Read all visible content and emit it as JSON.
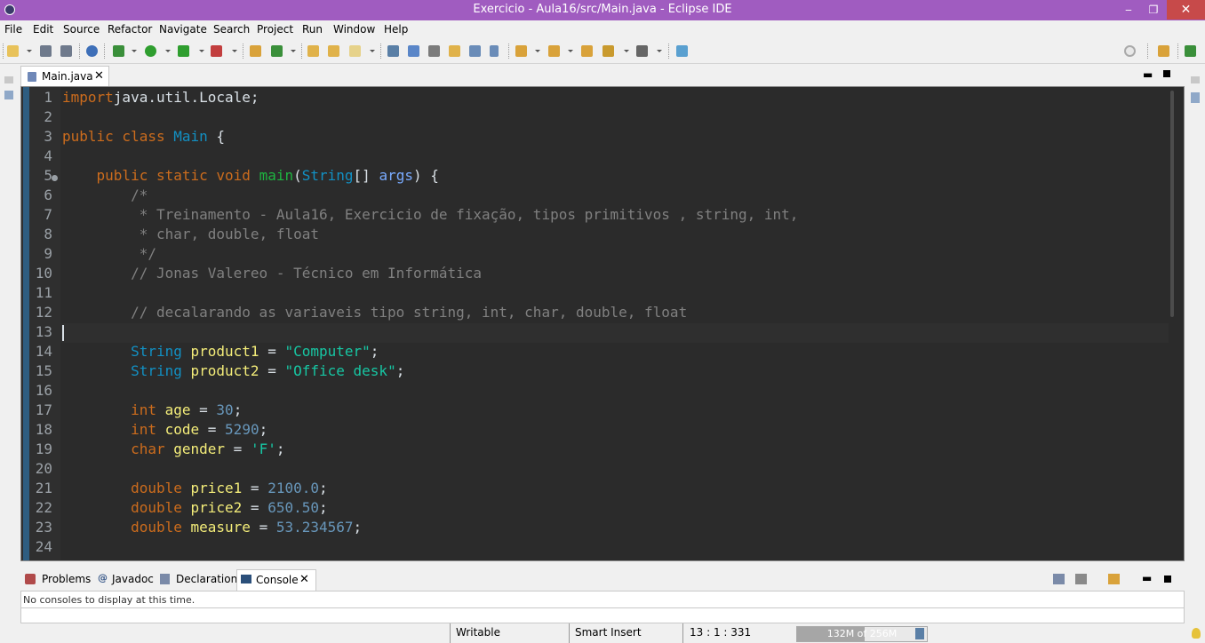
{
  "window": {
    "title": "Exercicio - Aula16/src/Main.java - Eclipse IDE",
    "minimize": "‒",
    "restore": "❐",
    "close": "✕"
  },
  "menu": [
    "File",
    "Edit",
    "Source",
    "Refactor",
    "Navigate",
    "Search",
    "Project",
    "Run",
    "Window",
    "Help"
  ],
  "editor": {
    "tab_label": "Main.java",
    "tab_close": "✕",
    "current_line": 13,
    "line_numbers": [
      "1",
      "2",
      "3",
      "4",
      "5",
      "6",
      "7",
      "8",
      "9",
      "10",
      "11",
      "12",
      "13",
      "14",
      "15",
      "16",
      "17",
      "18",
      "19",
      "20",
      "21",
      "22",
      "23",
      "24"
    ],
    "lines": [
      [
        [
          "k",
          "import"
        ],
        [
          "",
          "java.util.Locale;"
        ]
      ],
      [],
      [
        [
          "k",
          "public class"
        ],
        [
          "",
          " "
        ],
        [
          "cl",
          "Main"
        ],
        [
          "",
          " {"
        ]
      ],
      [],
      [
        [
          "",
          ""
        ],
        [
          "k",
          "    public static void"
        ],
        [
          "",
          " "
        ],
        [
          "m",
          "main"
        ],
        [
          "",
          "("
        ],
        [
          "cl",
          "String"
        ],
        [
          "",
          "[] "
        ],
        [
          "p",
          "args"
        ],
        [
          "",
          ") {"
        ]
      ],
      [
        [
          "c",
          "        /*"
        ]
      ],
      [
        [
          "c",
          "         * Treinamento - Aula16, Exercicio de fixação, tipos primitivos , string, int,"
        ]
      ],
      [
        [
          "c",
          "         * char, double, float"
        ]
      ],
      [
        [
          "c",
          "         */"
        ]
      ],
      [
        [
          "c",
          "        // Jonas Valereo - Técnico em Informática"
        ]
      ],
      [],
      [
        [
          "c",
          "        // decalarando as variaveis tipo string, int, char, double, float"
        ]
      ],
      [],
      [
        [
          "cl",
          "        String"
        ],
        [
          "",
          " "
        ],
        [
          "v",
          "product1"
        ],
        [
          "",
          " = "
        ],
        [
          "s",
          "\"Computer\""
        ],
        [
          "",
          ";"
        ]
      ],
      [
        [
          "cl",
          "        String"
        ],
        [
          "",
          " "
        ],
        [
          "v",
          "product2"
        ],
        [
          "",
          " = "
        ],
        [
          "s",
          "\"Office desk\""
        ],
        [
          "",
          ";"
        ]
      ],
      [],
      [
        [
          "k",
          "        int"
        ],
        [
          "",
          " "
        ],
        [
          "v",
          "age"
        ],
        [
          "",
          " = "
        ],
        [
          "n",
          "30"
        ],
        [
          "",
          ";"
        ]
      ],
      [
        [
          "k",
          "        int"
        ],
        [
          "",
          " "
        ],
        [
          "v",
          "code"
        ],
        [
          "",
          " = "
        ],
        [
          "n",
          "5290"
        ],
        [
          "",
          ";"
        ]
      ],
      [
        [
          "k",
          "        char"
        ],
        [
          "",
          " "
        ],
        [
          "v",
          "gender"
        ],
        [
          "",
          " = "
        ],
        [
          "s",
          "'F'"
        ],
        [
          "",
          ";"
        ]
      ],
      [],
      [
        [
          "k",
          "        double"
        ],
        [
          "",
          " "
        ],
        [
          "v",
          "price1"
        ],
        [
          "",
          " = "
        ],
        [
          "n",
          "2100.0"
        ],
        [
          "",
          ";"
        ]
      ],
      [
        [
          "k",
          "        double"
        ],
        [
          "",
          " "
        ],
        [
          "v",
          "price2"
        ],
        [
          "",
          " = "
        ],
        [
          "n",
          "650.50"
        ],
        [
          "",
          ";"
        ]
      ],
      [
        [
          "k",
          "        double"
        ],
        [
          "",
          " "
        ],
        [
          "v",
          "measure"
        ],
        [
          "",
          " = "
        ],
        [
          "n",
          "53.234567"
        ],
        [
          "",
          ";"
        ]
      ],
      []
    ]
  },
  "bottom_panel": {
    "tabs": [
      "Problems",
      "Javadoc",
      "Declaration",
      "Console"
    ],
    "active_tab": "Console",
    "console_close": "✕",
    "console_message": "No consoles to display at this time."
  },
  "status": {
    "writable": "Writable",
    "insert_mode": "Smart Insert",
    "position": "13 : 1 : 331",
    "heap": "132M of 256M",
    "heap_used_fraction": 0.52
  },
  "colors": {
    "titlebar": "#a05cc0",
    "editor_bg": "#2b2b2b",
    "keyword": "#cc6c1d",
    "class": "#1290c3",
    "string": "#17c6a3",
    "number": "#6897bb",
    "comment": "#808080",
    "variable": "#f3ec79"
  }
}
